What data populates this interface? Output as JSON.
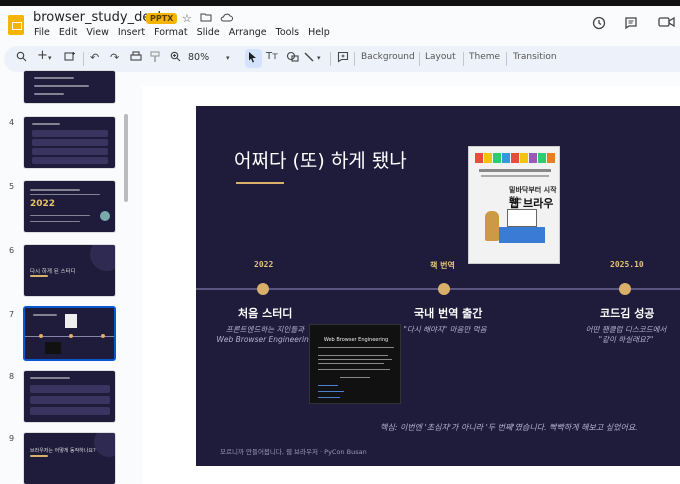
{
  "doc": {
    "title": "browser_study_deck",
    "badge": "PPTX"
  },
  "menu": [
    "File",
    "Edit",
    "View",
    "Insert",
    "Format",
    "Slide",
    "Arrange",
    "Tools",
    "Help"
  ],
  "toolbar": {
    "zoom": "80%",
    "background": "Background",
    "layout": "Layout",
    "theme": "Theme",
    "transition": "Transition"
  },
  "icons": {
    "star": "star-icon",
    "folder": "folder-icon",
    "cloud": "cloud-icon",
    "history": "history-icon",
    "comments": "comment-icon",
    "meet": "video-icon"
  },
  "slides": [
    {
      "number": "4"
    },
    {
      "number": "5",
      "big": "2022"
    },
    {
      "number": "6",
      "text": "다시 하게 된 스터디"
    },
    {
      "number": "7"
    },
    {
      "number": "8"
    },
    {
      "number": "9",
      "text": "브라우저는 어떻게 동작하나요?"
    }
  ],
  "slide": {
    "title": "어쩌다 (또) 하게 됐나",
    "book": {
      "line1": "밑바닥부터 시작하는",
      "line2": "웹 브라우저"
    },
    "timeline": [
      {
        "year": "2022",
        "event": "처음 스터디",
        "sub1": "프론트엔드하는 지인들과",
        "sub2": "Web Browser Engineering"
      },
      {
        "year": "책 번역",
        "event": "국내 번역 출간",
        "sub1": "\"다시 해야지\" 마음만 먹음",
        "sub2": ""
      },
      {
        "year": "2025.10",
        "event": "코드김 성공",
        "sub1": "어떤 팬클럽 디스코드에서",
        "sub2": "\"같이 하실래요?\""
      }
    ],
    "screenshot_title": "Web Browser Engineering",
    "note": "핵심: 이번엔 '초심자'가 아니라 '두 번째'였습니다. 빡빡하게 해보고 싶었어요.",
    "footer": "모르니까 만들어봅니다, 웹 브라우저  ·  PyCon Busan"
  }
}
